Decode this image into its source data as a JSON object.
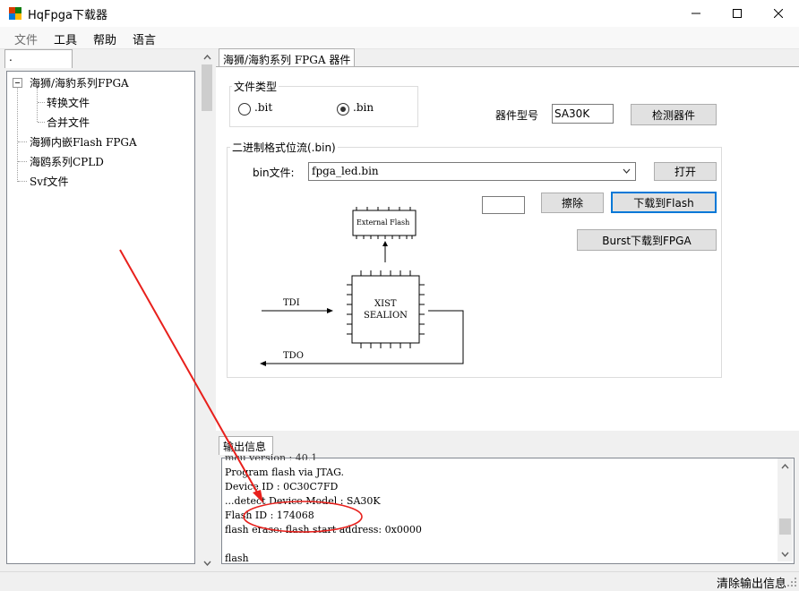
{
  "window": {
    "title": "HqFpga下载器"
  },
  "menu": {
    "items": [
      "文件",
      "工具",
      "帮助",
      "语言"
    ]
  },
  "left_tab": {
    "label": "."
  },
  "tree": {
    "root": "海狮/海豹系列FPGA",
    "children": [
      "转换文件",
      "合并文件"
    ],
    "items": [
      "海狮内嵌Flash FPGA",
      "海鸥系列CPLD",
      "Svf文件"
    ]
  },
  "main_tab": {
    "label": "海狮/海豹系列 FPGA 器件"
  },
  "file_type": {
    "label": "文件类型",
    "options": [
      ".bit",
      ".bin"
    ],
    "selected": ".bin"
  },
  "device": {
    "label": "器件型号",
    "value": "SA30K",
    "detect_button": "检测器件"
  },
  "bitstream": {
    "group_label": "二进制格式位流(.bin)",
    "file_label": "bin文件:",
    "file_value": "fpga_led.bin",
    "open_button": "打开",
    "erase_button": "擦除",
    "download_flash_button": "下载到Flash",
    "burst_button": "Burst下载到FPGA"
  },
  "diagram": {
    "flash_label": "External Flash",
    "chip_line1": "XIST",
    "chip_line2": "SEALION",
    "tdi": "TDI",
    "tdo": "TDO"
  },
  "output": {
    "tab_label": "输出信息",
    "lines": [
      "Program flash via JTAG.",
      "Device ID : 0C30C7FD",
      "...detect Device Model : SA30K",
      "Flash ID : 174068",
      "flash erase: flash start address: 0x0000",
      "",
      "flash"
    ]
  },
  "status": {
    "clear_button": "清除输出信息"
  }
}
